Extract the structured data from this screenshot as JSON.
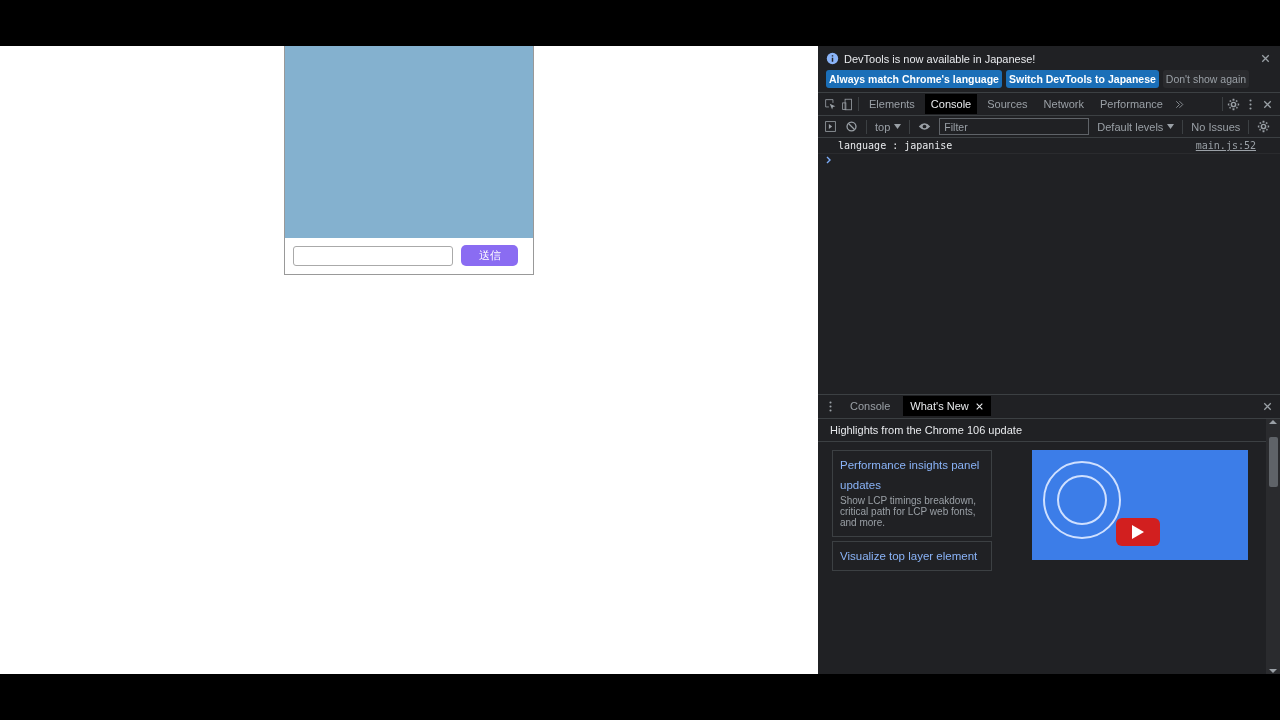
{
  "page": {
    "chat": {
      "send_button": "送信"
    }
  },
  "devtools": {
    "infobar": {
      "message": "DevTools is now available in Japanese!",
      "buttons": [
        {
          "label": "Always match Chrome's language",
          "kind": "primary"
        },
        {
          "label": "Switch DevTools to Japanese",
          "kind": "primary"
        },
        {
          "label": "Don't show again",
          "kind": "plain"
        }
      ]
    },
    "tabs": [
      {
        "label": "Elements",
        "selected": false
      },
      {
        "label": "Console",
        "selected": true
      },
      {
        "label": "Sources",
        "selected": false
      },
      {
        "label": "Network",
        "selected": false
      },
      {
        "label": "Performance",
        "selected": false
      }
    ],
    "toolbar": {
      "context": "top",
      "filter": {
        "placeholder": "Filter"
      },
      "levels": "Default levels",
      "issues": "No Issues"
    },
    "console_messages": [
      {
        "text": "language : japanise",
        "source": "main.js:52"
      }
    ],
    "drawer": {
      "tabs": [
        {
          "label": "Console",
          "selected": false,
          "closable": false
        },
        {
          "label": "What's New",
          "selected": true,
          "closable": true
        }
      ],
      "heading": "Highlights from the Chrome 106 update",
      "cards": [
        {
          "title": "Performance insights panel updates",
          "description": "Show LCP timings breakdown, critical path for LCP web fonts, and more."
        },
        {
          "title": "Visualize top layer element"
        }
      ]
    }
  }
}
